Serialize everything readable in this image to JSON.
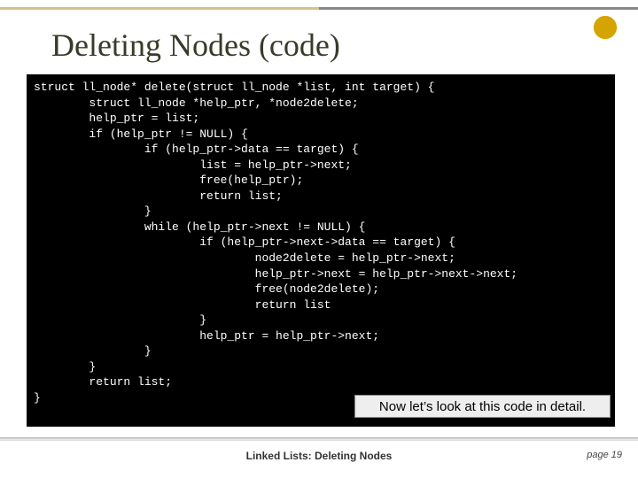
{
  "title": "Deleting Nodes (code)",
  "code": "struct ll_node* delete(struct ll_node *list, int target) {\n        struct ll_node *help_ptr, *node2delete;\n        help_ptr = list;\n        if (help_ptr != NULL) {\n                if (help_ptr->data == target) {\n                        list = help_ptr->next;\n                        free(help_ptr);\n                        return list;\n                }\n                while (help_ptr->next != NULL) {\n                        if (help_ptr->next->data == target) {\n                                node2delete = help_ptr->next;\n                                help_ptr->next = help_ptr->next->next;\n                                free(node2delete);\n                                return list\n                        }\n                        help_ptr = help_ptr->next;\n                }\n        }\n        return list;\n}",
  "callout": "Now let’s look at this code in detail.",
  "footer": {
    "title": "Linked Lists:  Deleting Nodes",
    "page_label": "page 19"
  },
  "colors": {
    "code_bg": "#000000",
    "code_fg": "#ffffff",
    "accent": "#d4c38a"
  }
}
